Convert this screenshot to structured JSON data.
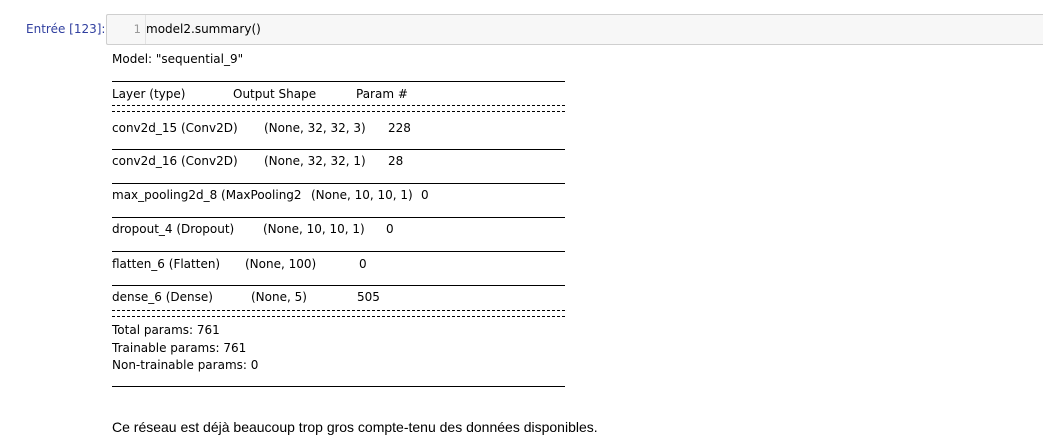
{
  "cell": {
    "prompt": "Entrée [123]:",
    "line_number": "1",
    "code": "model2.summary()"
  },
  "output": {
    "model_line": "Model: \"sequential_9\"",
    "headers": {
      "layer": "Layer (type)",
      "shape": "Output Shape",
      "params": "Param #"
    },
    "rows": [
      {
        "layer": "conv2d_15 (Conv2D)",
        "shape": "(None, 32, 32, 3)",
        "params": "228"
      },
      {
        "layer": "conv2d_16 (Conv2D)",
        "shape": "(None, 32, 32, 1)",
        "params": "28"
      },
      {
        "layer": "max_pooling2d_8 (MaxPooling2",
        "shape": "(None, 10, 10, 1)",
        "params": "0"
      },
      {
        "layer": "dropout_4 (Dropout)",
        "shape": "(None, 10, 10, 1)",
        "params": "0"
      },
      {
        "layer": "flatten_6 (Flatten)",
        "shape": "(None, 100)",
        "params": "0"
      },
      {
        "layer": "dense_6 (Dense)",
        "shape": "(None, 5)",
        "params": "505"
      }
    ],
    "total_params": "Total params: 761",
    "trainable_params": "Trainable params: 761",
    "non_trainable_params": "Non-trainable params: 0"
  },
  "markdown": {
    "text": "Ce réseau est déjà beaucoup trop gros compte-tenu des données disponibles."
  }
}
